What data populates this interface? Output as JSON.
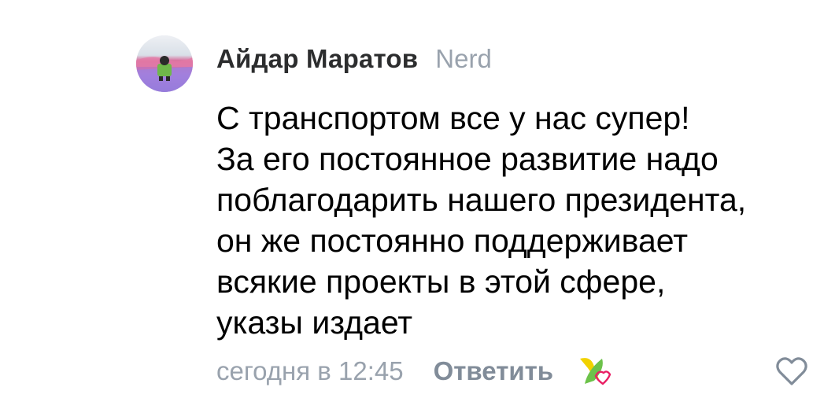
{
  "comment": {
    "author": "Айдар Маратов",
    "badge": "Nerd",
    "text_lines": [
      "С транспортом все у нас супер!",
      "За его постоянное развитие надо",
      "поблагодарить нашего президента,",
      "он же постоянно поддерживает",
      "всякие проекты в этой сфере,",
      "указы издает"
    ],
    "timestamp": "сегодня в 12:45",
    "reply_label": "Ответить",
    "avatar_icon": "user-avatar-photo",
    "reaction_icon": "reaction-badge-icon",
    "like_icon": "heart-outline-icon"
  },
  "colors": {
    "author": "#2c2d2e",
    "secondary_text": "#99a2ad",
    "reply_button": "#818c99",
    "body_text": "#000000",
    "reaction_green": "#6cc24a",
    "reaction_yellow": "#f2d200",
    "reaction_pink": "#e91e63",
    "heart": "#818c99"
  }
}
